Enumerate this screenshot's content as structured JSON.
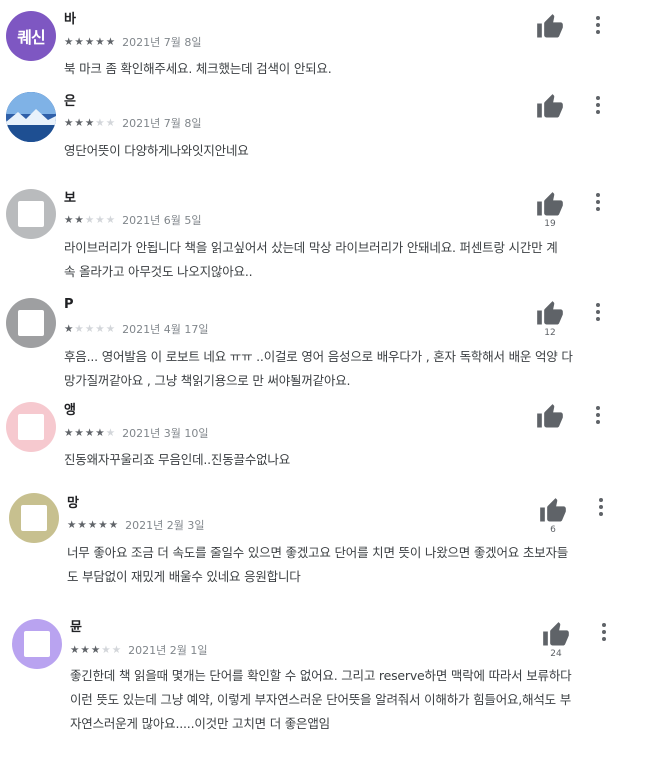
{
  "reviews": [
    {
      "name": "바",
      "avatar": {
        "kind": "text",
        "label": "퀘신",
        "color": "#7e57c2"
      },
      "rating": 5,
      "date": "2021년 7월 8일",
      "text": [
        "북 마크 좀 확인해주세요. 체크했는데 검색이 안되요."
      ],
      "likes": ""
    },
    {
      "name": "은",
      "avatar": {
        "kind": "photo",
        "color": "#3b6fb6"
      },
      "rating": 3,
      "date": "2021년 7월 8일",
      "text": [
        "영단어뜻이 다양하게나와잇지안네요"
      ],
      "likes": ""
    },
    {
      "name": "보",
      "avatar": {
        "kind": "blank",
        "color": "#b9bbbd"
      },
      "rating": 2,
      "date": "2021년 6월 5일",
      "text": [
        "라이브러리가 안됩니다 책을 읽고싶어서 샀는데 막상 라이브러리가 안돼네요. 퍼센트랑 시간만 계",
        "속 올라가고 아무것도 나오지않아요.."
      ],
      "likes": "19"
    },
    {
      "name": "P",
      "avatar": {
        "kind": "blank",
        "color": "#9e9fa1"
      },
      "rating": 1,
      "date": "2021년 4월 17일",
      "text": [
        "후음... 영어발음 이 로보트 네요 ㅠㅠ ..이걸로 영어 음성으로 배우다가 , 혼자 독학해서 배운 억양 다",
        "망가질꺼같아요 , 그냥 책읽기용으로 만 써야될꺼같아요."
      ],
      "likes": "12"
    },
    {
      "name": "앵",
      "avatar": {
        "kind": "blank",
        "color": "#f6c9cf"
      },
      "rating": 4,
      "date": "2021년 3월 10일",
      "text": [
        "진동왜자꾸울리죠 무음인데..진동끌수없나요"
      ],
      "likes": ""
    },
    {
      "name": "망",
      "avatar": {
        "kind": "blank",
        "color": "#c7c08f"
      },
      "rating": 5,
      "date": "2021년 2월 3일",
      "text": [
        "너무 좋아요 조금 더 속도를 줄일수 있으면 좋겠고요 단어를 치면 뜻이 나왔으면 좋겠어요 초보자들",
        "도 부담없이 재밌게 배울수 있네요 응원합니다"
      ],
      "likes": "6"
    },
    {
      "name": "뮨",
      "avatar": {
        "kind": "blank",
        "color": "#b9a3f0"
      },
      "rating": 3,
      "date": "2021년 2월 1일",
      "text": [
        "좋긴한데 책 읽을때 몇개는 단어를 확인할 수 없어요. 그리고 reserve하면 맥락에 따라서 보류하다",
        "이런 뜻도 있는데 그냥 예약, 이렇게 부자연스러운 단어뜻을 알려줘서 이해하가 힘들어요,해석도 부",
        "자연스러운게 많아요.....이것만 고치면 더 좋은앱임"
      ],
      "likes": "24"
    }
  ],
  "icons": {
    "like": "thumb-up-icon",
    "more": "more-vert-icon"
  },
  "colors": {
    "star_on": "#5f6368",
    "star_off": "#d3d6da",
    "icon": "#5f6368"
  }
}
